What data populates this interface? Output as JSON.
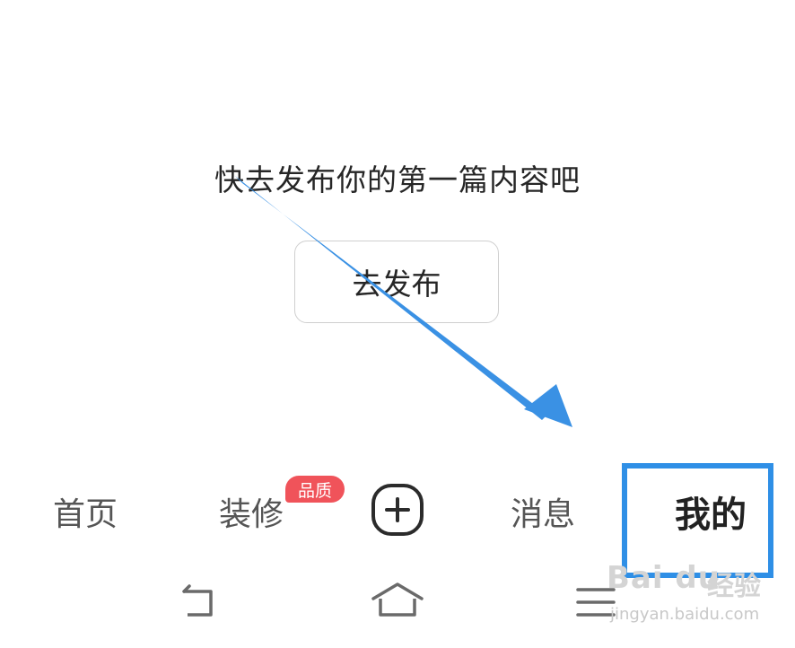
{
  "empty_state": {
    "message": "快去发布你的第一篇内容吧",
    "publish_button_label": "去发布"
  },
  "tabbar": {
    "home": "首页",
    "decor": "装修",
    "decor_badge": "品质",
    "messages": "消息",
    "mine": "我的",
    "plus_icon": "plus-circle-icon"
  },
  "system_nav": {
    "icons": [
      "back-icon",
      "home-icon",
      "menu-icon"
    ]
  },
  "watermark": {
    "logo": "Bai du",
    "label": "经验",
    "url": "jingyan.baidu.com"
  },
  "annotation": {
    "arrow_color": "#3a91e4",
    "box_color": "#2f8fe6"
  }
}
